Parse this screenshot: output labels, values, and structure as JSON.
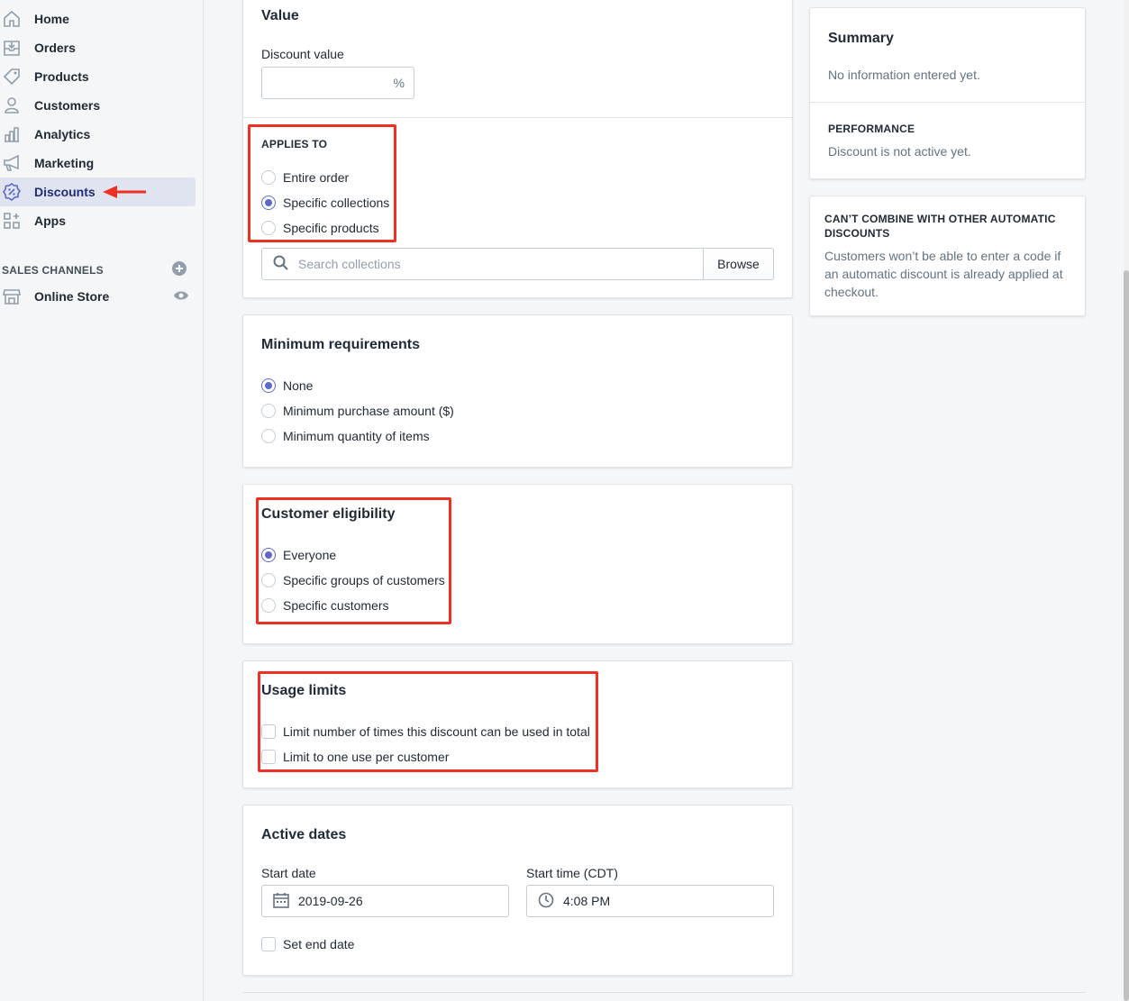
{
  "sidebar": {
    "items": [
      {
        "label": "Home",
        "icon": "home-icon"
      },
      {
        "label": "Orders",
        "icon": "orders-icon"
      },
      {
        "label": "Products",
        "icon": "products-icon"
      },
      {
        "label": "Customers",
        "icon": "customers-icon"
      },
      {
        "label": "Analytics",
        "icon": "analytics-icon"
      },
      {
        "label": "Marketing",
        "icon": "marketing-icon"
      },
      {
        "label": "Discounts",
        "icon": "discounts-icon",
        "active": true
      },
      {
        "label": "Apps",
        "icon": "apps-icon"
      }
    ],
    "channels_title": "SALES CHANNELS",
    "online_store": "Online Store"
  },
  "value_card": {
    "title": "Value",
    "discount_label": "Discount value",
    "discount_value": "",
    "suffix": "%",
    "applies_to_title": "APPLIES TO",
    "applies_options": [
      "Entire order",
      "Specific collections",
      "Specific products"
    ],
    "applies_selected": "Specific collections",
    "search_placeholder": "Search collections",
    "browse_label": "Browse"
  },
  "min_req": {
    "title": "Minimum requirements",
    "options": [
      "None",
      "Minimum purchase amount ($)",
      "Minimum quantity of items"
    ],
    "selected": "None"
  },
  "eligibility": {
    "title": "Customer eligibility",
    "options": [
      "Everyone",
      "Specific groups of customers",
      "Specific customers"
    ],
    "selected": "Everyone"
  },
  "usage": {
    "title": "Usage limits",
    "options": [
      "Limit number of times this discount can be used in total",
      "Limit to one use per customer"
    ]
  },
  "dates": {
    "title": "Active dates",
    "start_date_label": "Start date",
    "start_date": "2019-09-26",
    "start_time_label": "Start time (CDT)",
    "start_time": "4:08 PM",
    "end_date_label": "Set end date"
  },
  "summary": {
    "title": "Summary",
    "empty": "No information entered yet.",
    "performance_title": "PERFORMANCE",
    "performance_text": "Discount is not active yet."
  },
  "combine": {
    "title": "CAN’T COMBINE WITH OTHER AUTOMATIC DISCOUNTS",
    "text": "Customers won’t be able to enter a code if an automatic discount is already applied at checkout."
  },
  "colors": {
    "accent": "#5c6ac4",
    "highlight": "#ee3124",
    "active_nav": "#e0e4f0"
  }
}
